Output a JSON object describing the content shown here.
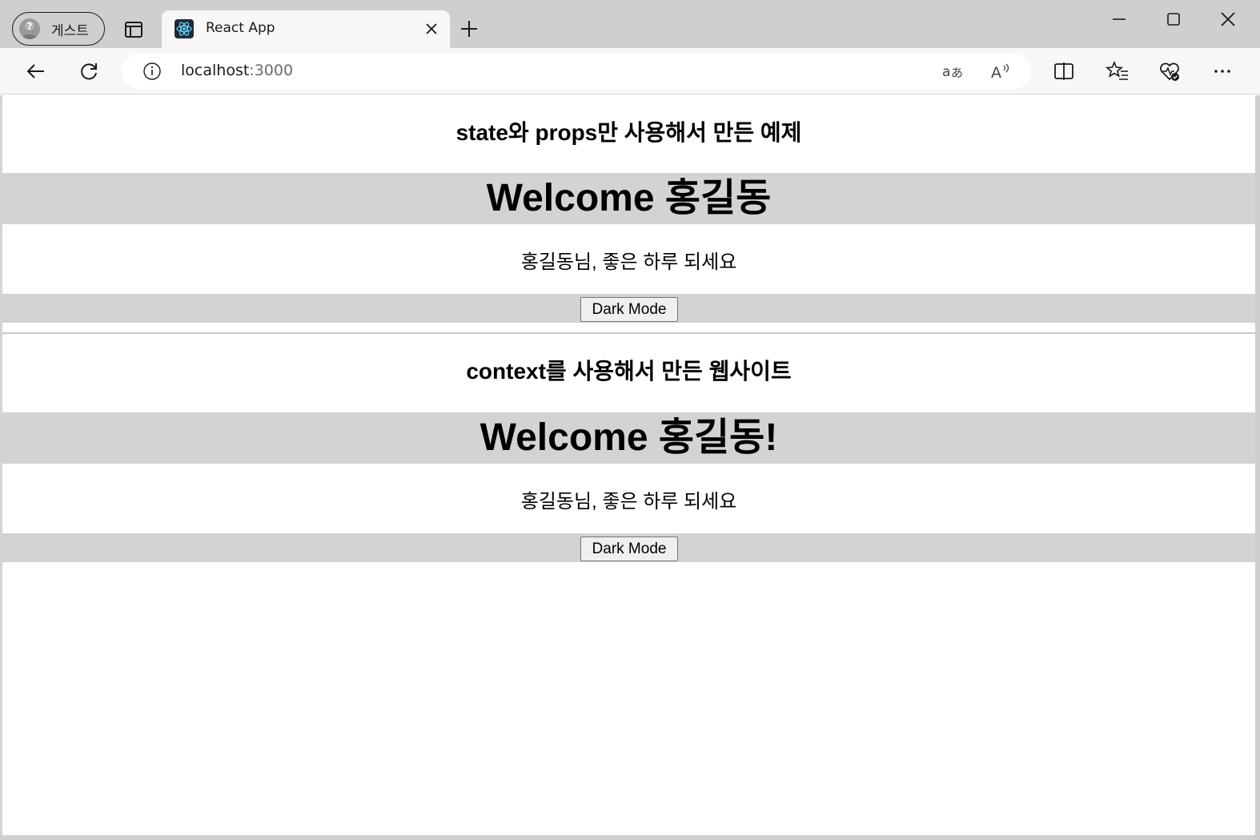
{
  "browser": {
    "profile_label": "게스트",
    "tab_title": "React App",
    "url_host": "localhost",
    "url_port": ":3000"
  },
  "colors": {
    "band": "#d3d3d3",
    "chrome": "#cfcfcf",
    "toolbar": "#f7f7f7",
    "react_blue": "#61dafb"
  },
  "icons": [
    "profile-icon",
    "tab-actions-icon",
    "react-logo-icon",
    "close-icon",
    "plus-icon",
    "minimize-icon",
    "maximize-icon",
    "close-window-icon",
    "back-icon",
    "refresh-icon",
    "info-icon",
    "translate-icon",
    "read-aloud-icon",
    "split-screen-icon",
    "favorites-icon",
    "browser-essentials-icon",
    "more-icon"
  ],
  "sections": [
    {
      "title": "state와 props만 사용해서 만든 예제",
      "welcome": "Welcome 홍길동",
      "greeting": "홍길동님, 좋은 하루 되세요",
      "button_label": "Dark Mode"
    },
    {
      "title": "context를 사용해서 만든 웹사이트",
      "welcome": "Welcome 홍길동!",
      "greeting": "홍길동님, 좋은 하루 되세요",
      "button_label": "Dark Mode"
    }
  ]
}
